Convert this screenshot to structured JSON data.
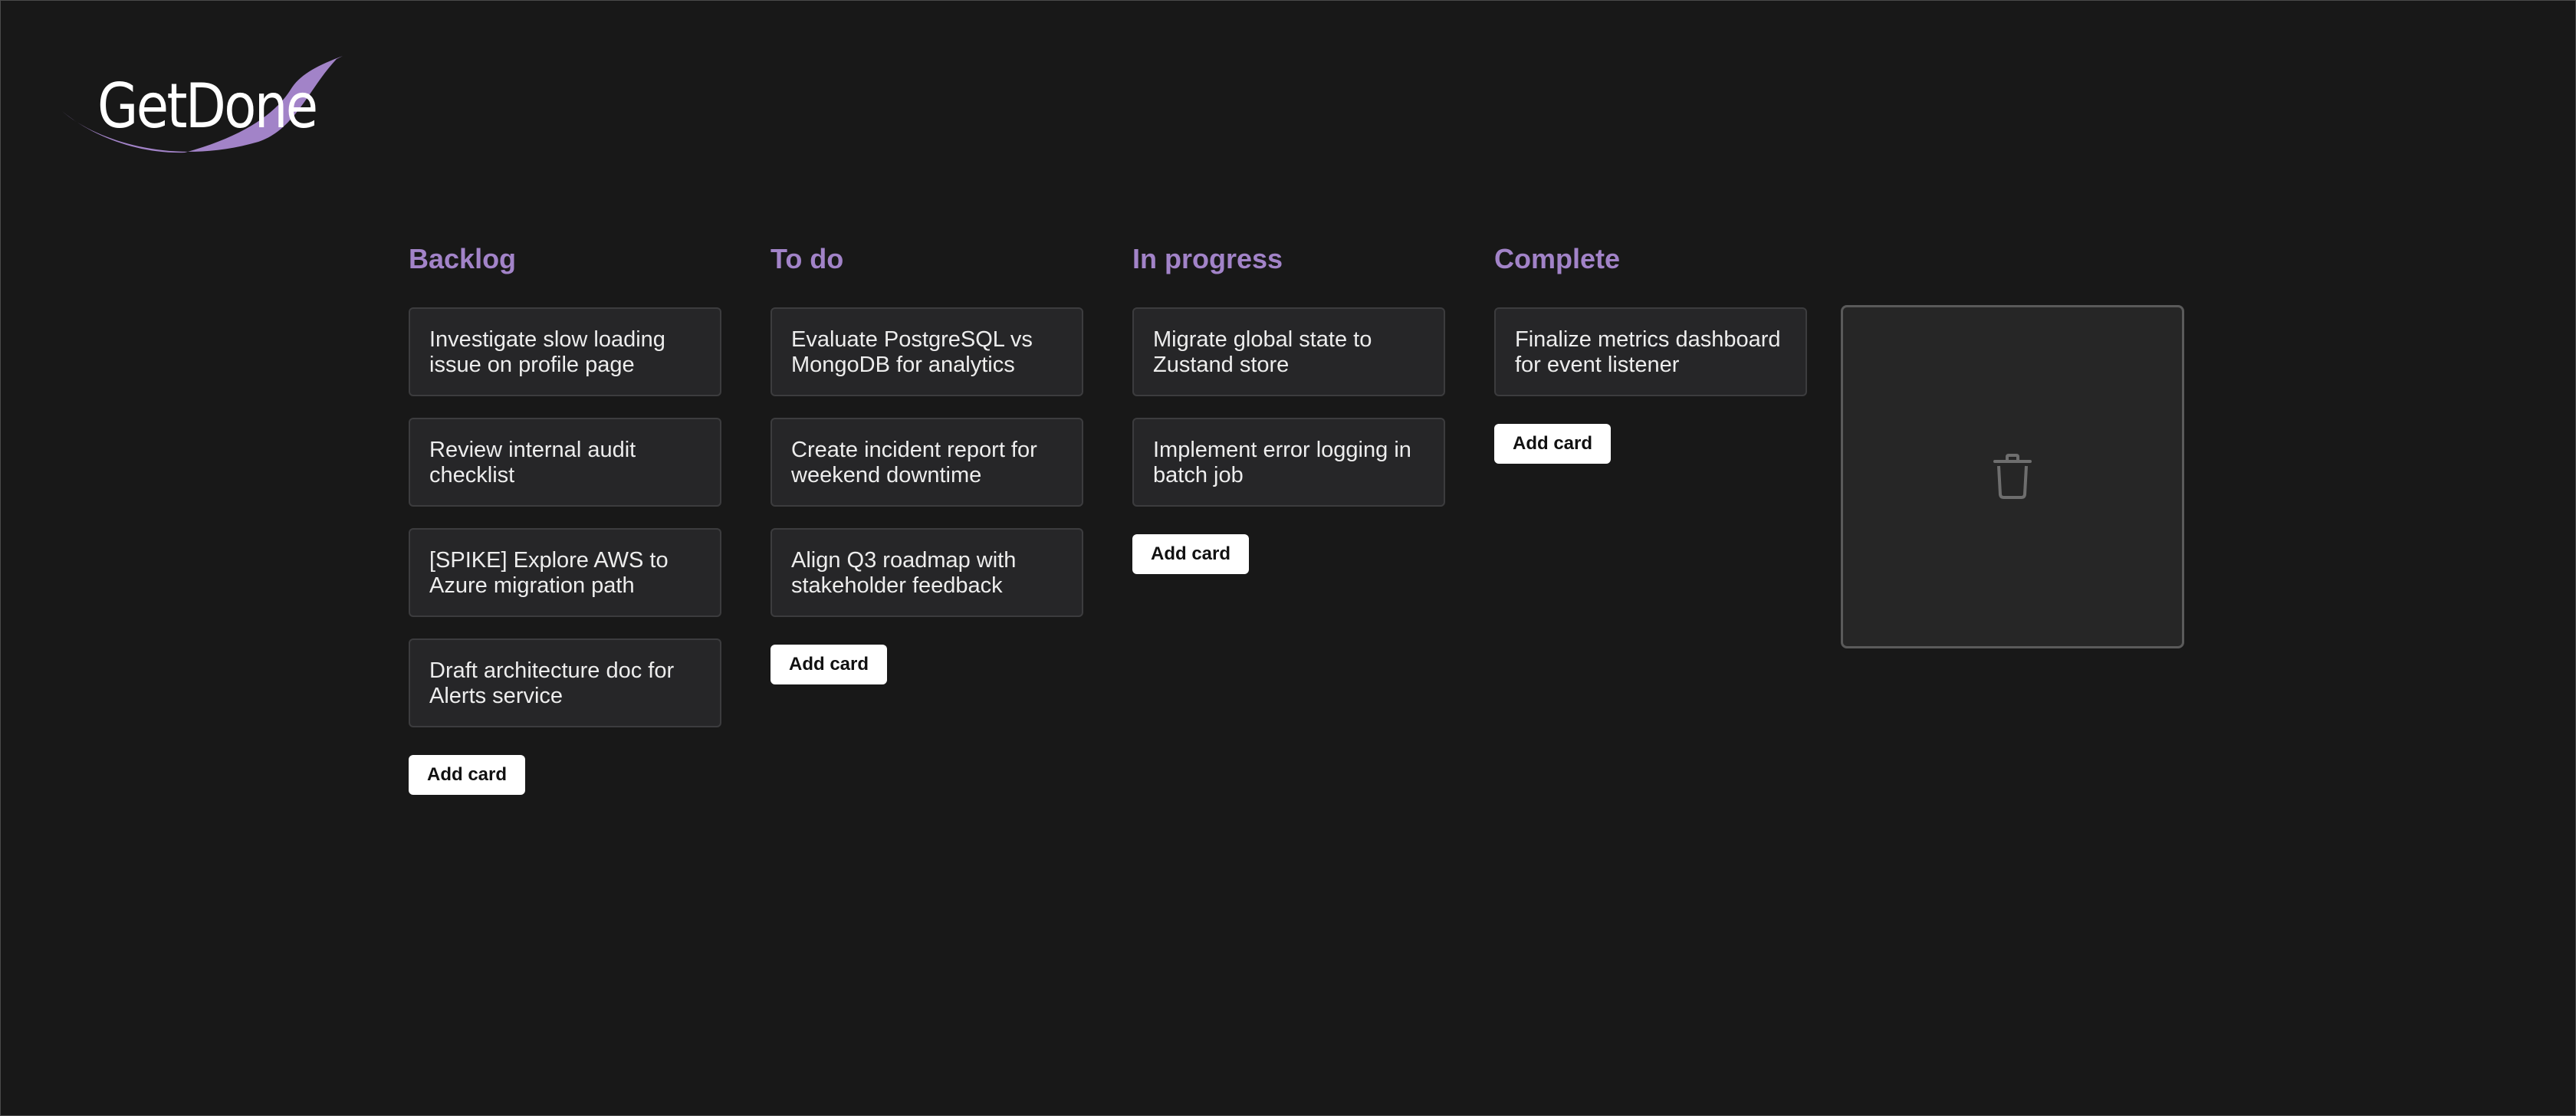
{
  "app": {
    "logo_text": "GetDone",
    "logo_accent_color": "#a283c8"
  },
  "board": {
    "columns": [
      {
        "title": "Backlog",
        "cards": [
          "Investigate slow loading issue on profile page",
          "Review internal audit checklist",
          "[SPIKE] Explore AWS to Azure migration path",
          "Draft architecture doc for Alerts service"
        ],
        "add_label": "Add card"
      },
      {
        "title": "To do",
        "cards": [
          "Evaluate PostgreSQL vs MongoDB for analytics",
          "Create incident report for weekend downtime",
          "Align Q3 roadmap with stakeholder feedback"
        ],
        "add_label": "Add card"
      },
      {
        "title": "In progress",
        "cards": [
          "Migrate global state to Zustand store",
          "Implement error logging in batch job"
        ],
        "add_label": "Add card"
      },
      {
        "title": "Complete",
        "cards": [
          "Finalize metrics dashboard for event listener"
        ],
        "add_label": "Add card"
      }
    ],
    "trash_icon": "trash-icon"
  },
  "colors": {
    "background": "#181818",
    "column_title": "#a283c8",
    "card_background": "#262628",
    "card_border": "#3c3c3e",
    "button_background": "#ffffff"
  }
}
